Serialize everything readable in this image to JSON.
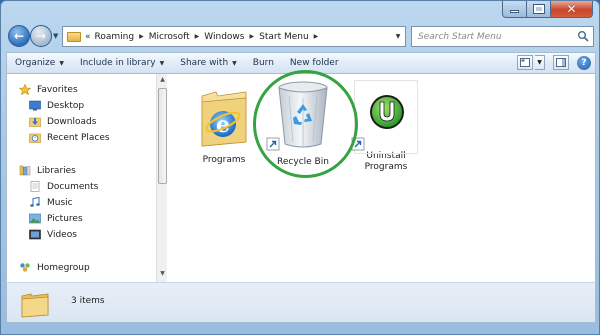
{
  "window": {
    "controls": {
      "minimize": "minimize",
      "maximize": "maximize",
      "close": "close"
    }
  },
  "address": {
    "overflow_chevron": "«",
    "crumbs": [
      "Roaming",
      "Microsoft",
      "Windows",
      "Start Menu"
    ]
  },
  "search": {
    "placeholder": "Search Start Menu"
  },
  "commands": {
    "organize": "Organize",
    "include_in_library": "Include in library",
    "share_with": "Share with",
    "burn": "Burn",
    "new_folder": "New folder",
    "help": "?"
  },
  "navpane": {
    "favorites": {
      "label": "Favorites",
      "items": [
        "Desktop",
        "Downloads",
        "Recent Places"
      ]
    },
    "libraries": {
      "label": "Libraries",
      "items": [
        "Documents",
        "Music",
        "Pictures",
        "Videos"
      ]
    },
    "homegroup": {
      "label": "Homegroup"
    }
  },
  "files": [
    {
      "name": "Programs"
    },
    {
      "name": "Recycle Bin"
    },
    {
      "name": "Uninstall Programs",
      "lines": [
        "Uninstall",
        "Programs"
      ]
    }
  ],
  "status": {
    "text": "3 items"
  },
  "colors": {
    "annotation_circle": "#35a340",
    "uninstaller_green": "#3db43f"
  },
  "icons": {
    "back": "back-arrow-icon",
    "forward": "forward-arrow-icon",
    "folder": "folder-icon",
    "search": "search-icon",
    "refresh": "refresh-icon"
  }
}
